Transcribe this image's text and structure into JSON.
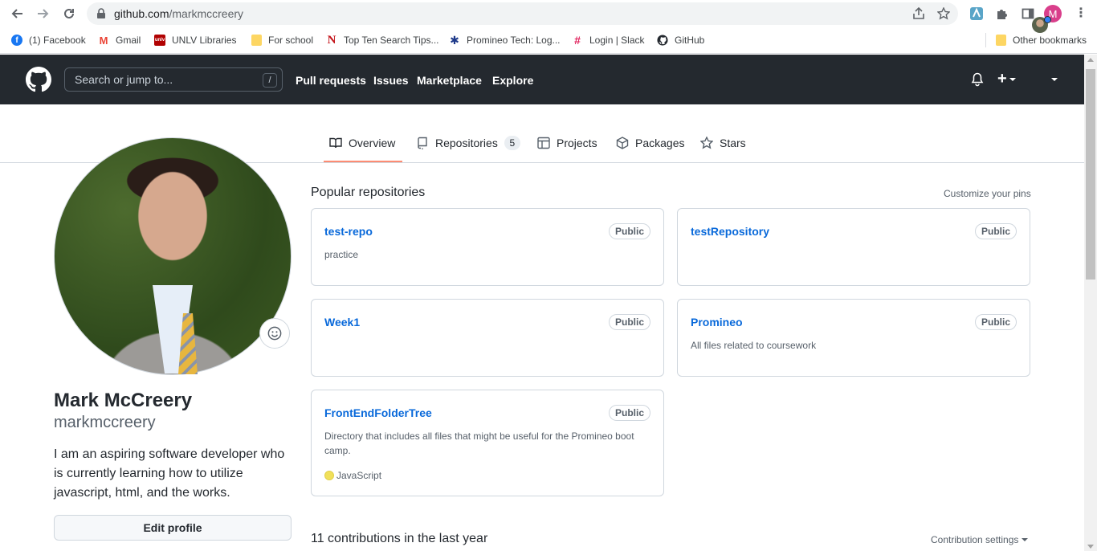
{
  "browser": {
    "url_host": "github.com",
    "url_path": "/markmccreery",
    "bookmarks": [
      {
        "label": "(1) Facebook",
        "color": "#1877f2",
        "glyph": "f"
      },
      {
        "label": "Gmail",
        "color": "#ea4335",
        "glyph": "M"
      },
      {
        "label": "UNLV Libraries",
        "color": "#b10202",
        "glyph": "unlv"
      },
      {
        "label": "For school",
        "color": "#fdd663",
        "glyph": "folder"
      },
      {
        "label": "Top Ten Search Tips...",
        "color": "#c4161c",
        "glyph": "N"
      },
      {
        "label": "Promineo Tech: Log...",
        "color": "#1e3a8a",
        "glyph": "✱"
      },
      {
        "label": "Login | Slack",
        "color": "#e01e5a",
        "glyph": "#"
      },
      {
        "label": "GitHub",
        "color": "#24292f",
        "glyph": "gh"
      }
    ],
    "other_bookmarks": "Other bookmarks",
    "profile_initial": "M"
  },
  "header": {
    "search_placeholder": "Search or jump to...",
    "search_shortcut": "/",
    "nav": [
      "Pull requests",
      "Issues",
      "Marketplace",
      "Explore"
    ],
    "plus": "+"
  },
  "tabs": [
    {
      "label": "Overview",
      "icon": "book-icon",
      "selected": true
    },
    {
      "label": "Repositories",
      "icon": "repo-icon",
      "count": "5"
    },
    {
      "label": "Projects",
      "icon": "table-icon"
    },
    {
      "label": "Packages",
      "icon": "package-icon"
    },
    {
      "label": "Stars",
      "icon": "star-icon"
    }
  ],
  "profile": {
    "name": "Mark McCreery",
    "login": "markmccreery",
    "bio": "I am an aspiring software developer who is currently learning how to utilize javascript, html, and the works.",
    "edit_button": "Edit profile"
  },
  "popular": {
    "title": "Popular repositories",
    "customize": "Customize your pins",
    "repos": [
      {
        "name": "test-repo",
        "visibility": "Public",
        "description": "practice"
      },
      {
        "name": "testRepository",
        "visibility": "Public",
        "description": ""
      },
      {
        "name": "Week1",
        "visibility": "Public",
        "description": ""
      },
      {
        "name": "Promineo",
        "visibility": "Public",
        "description": "All files related to coursework"
      },
      {
        "name": "FrontEndFolderTree",
        "visibility": "Public",
        "description": "Directory that includes all files that might be useful for the Promineo boot camp.",
        "language": "JavaScript",
        "language_color": "#f1e05a"
      }
    ]
  },
  "contributions": {
    "title": "11 contributions in the last year",
    "settings": "Contribution settings"
  }
}
